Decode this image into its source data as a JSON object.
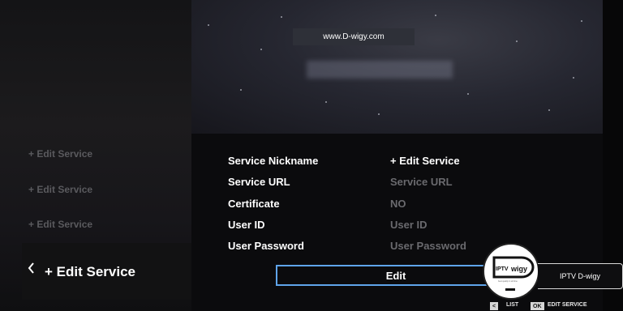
{
  "watermark": {
    "top_text": "www.D-wigy.com"
  },
  "sidebar": {
    "items": [
      {
        "label": "+ Edit Service"
      },
      {
        "label": "+ Edit Service"
      },
      {
        "label": "+ Edit Service"
      }
    ],
    "active": {
      "label": "+ Edit Service"
    }
  },
  "form": {
    "rows": [
      {
        "label": "Service Nickname",
        "value": "+ Edit Service"
      },
      {
        "label": "Service URL",
        "value": "Service URL"
      },
      {
        "label": "Certificate",
        "value": "NO"
      },
      {
        "label": "User ID",
        "value": "User ID"
      },
      {
        "label": "User Password",
        "value": "User Password"
      }
    ],
    "edit_button": "Edit"
  },
  "logo": {
    "badge_text": "IPTV D-wigy",
    "mark_left": "IPTV",
    "mark_right": "wigy",
    "mark_sub": "best quality in all time"
  },
  "footer": {
    "hints": [
      {
        "key": "<",
        "label": "LIST"
      },
      {
        "key": "OK",
        "label": "EDIT SERVICE"
      }
    ]
  },
  "colors": {
    "accent_border": "#5fa4ea",
    "active_text": "#ffffff",
    "dim_text": "#6a6a6e"
  }
}
